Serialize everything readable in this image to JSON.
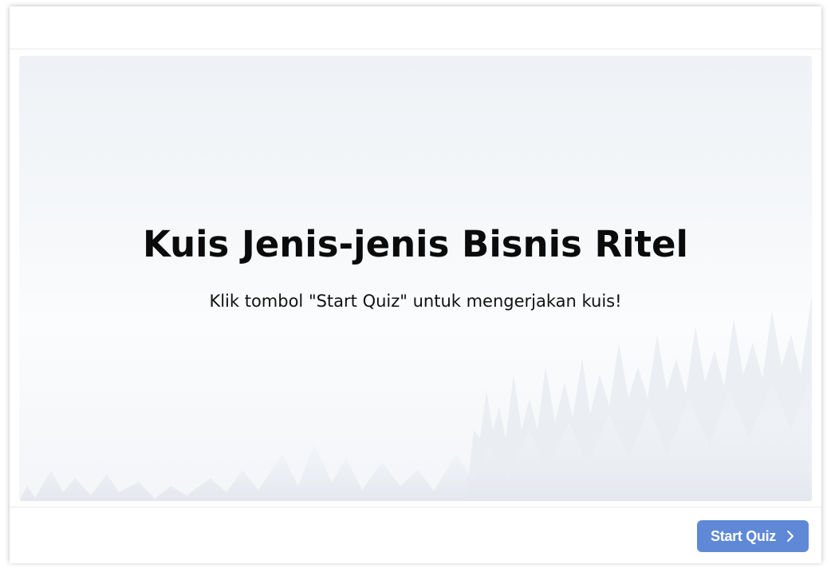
{
  "slide": {
    "title": "Kuis Jenis-jenis Bisnis Ritel",
    "subtitle": "Klik tombol \"Start Quiz\" untuk mengerjakan kuis!"
  },
  "footer": {
    "start_button_label": "Start Quiz",
    "start_button_icon": "chevron-right-icon"
  },
  "colors": {
    "accent": "#5f89d6",
    "text": "#0b0b0b",
    "background": "#f6f8fa"
  }
}
